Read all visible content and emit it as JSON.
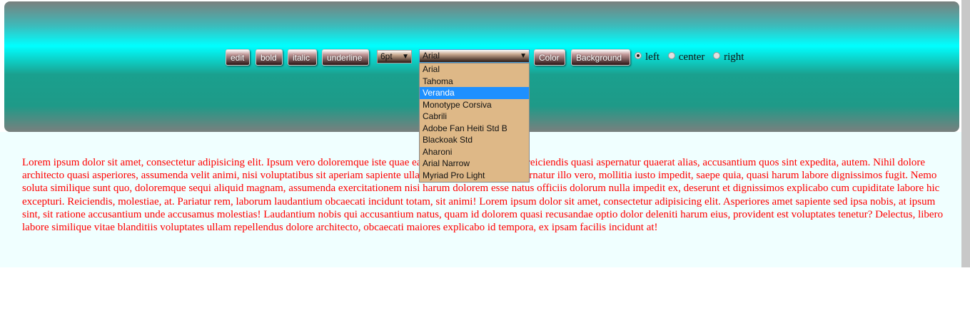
{
  "toolbar": {
    "buttons": {
      "edit": "edit",
      "bold": "bold",
      "italic": "italic",
      "underline": "underline",
      "color": "Color",
      "background": "Background"
    },
    "font_size": {
      "selected": "6pt"
    },
    "font_family": {
      "selected": "Arial",
      "options": [
        "Arial",
        "Tahoma",
        "Veranda",
        "Monotype Corsiva",
        "Cabrili",
        "Adobe Fan Heiti Std B",
        "Blackoak Std",
        "Aharoni",
        "Arial Narrow",
        "Myriad Pro Light"
      ],
      "highlighted": "Veranda"
    },
    "alignment": {
      "options": [
        "left",
        "center",
        "right"
      ],
      "selected": "left"
    }
  },
  "content": {
    "text": "Lorem ipsum dolor sit amet, consectetur adipisicing elit. Ipsum vero doloremque iste quae ea eveniet adipisci placeat reiciendis quasi aspernatur quaerat alias, accusantium quos sint expedita, autem. Nihil dolore architecto quasi asperiores, assumenda velit animi, nisi voluptatibus sit aperiam sapiente ullam deserunt impedit. Aspernatur illo vero, mollitia iusto impedit, saepe quia, quasi harum labore dignissimos fugit. Nemo soluta similique sunt quo, doloremque sequi aliquid magnam, assumenda exercitationem nisi harum dolorem esse natus officiis dolorum nulla impedit ex, deserunt et dignissimos explicabo cum cupiditate labore hic excepturi. Reiciendis, molestiae, at. Pariatur rem, laborum laudantium obcaecati incidunt totam, sit animi! Lorem ipsum dolor sit amet, consectetur adipisicing elit. Asperiores amet sapiente sed ipsa nobis, at ipsum sint, sit ratione accusantium unde accusamus molestias! Laudantium nobis qui accusantium natus, quam id dolorem quasi recusandae optio dolor deleniti harum eius, provident est voluptates tenetur? Delectus, libero labore similique vitae blanditiis voluptates ullam repellendus dolore architecto, obcaecati maiores explicabo id tempora, ex ipsam facilis incidunt at!"
  },
  "colors": {
    "text": "#ff0000",
    "content_bg": "#f0ffff",
    "dropdown_bg": "#deb887",
    "highlight": "#1e90ff"
  }
}
